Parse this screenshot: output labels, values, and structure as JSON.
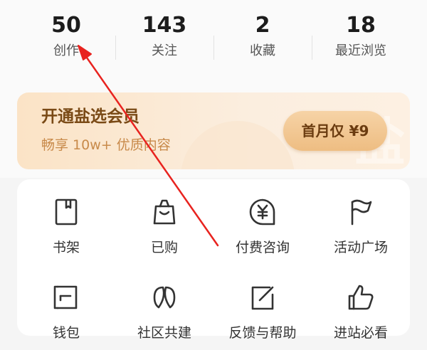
{
  "stats": [
    {
      "value": "50",
      "label": "创作"
    },
    {
      "value": "143",
      "label": "关注"
    },
    {
      "value": "2",
      "label": "收藏"
    },
    {
      "value": "18",
      "label": "最近浏览"
    }
  ],
  "vip": {
    "title": "开通盐选会员",
    "subtitle": "畅享 10w+ 优质内容",
    "button": "首月仅 ¥9",
    "watermark": "盐"
  },
  "tools": [
    {
      "label": "书架",
      "icon": "bookshelf-icon"
    },
    {
      "label": "已购",
      "icon": "shopping-bag-icon"
    },
    {
      "label": "付费咨询",
      "icon": "yen-chat-icon"
    },
    {
      "label": "活动广场",
      "icon": "flag-icon"
    },
    {
      "label": "钱包",
      "icon": "wallet-icon"
    },
    {
      "label": "社区共建",
      "icon": "community-icon"
    },
    {
      "label": "反馈与帮助",
      "icon": "edit-feedback-icon"
    },
    {
      "label": "进站必看",
      "icon": "thumbs-up-icon"
    }
  ],
  "annotation": {
    "color": "#e8231f",
    "icon": "red-arrow"
  }
}
